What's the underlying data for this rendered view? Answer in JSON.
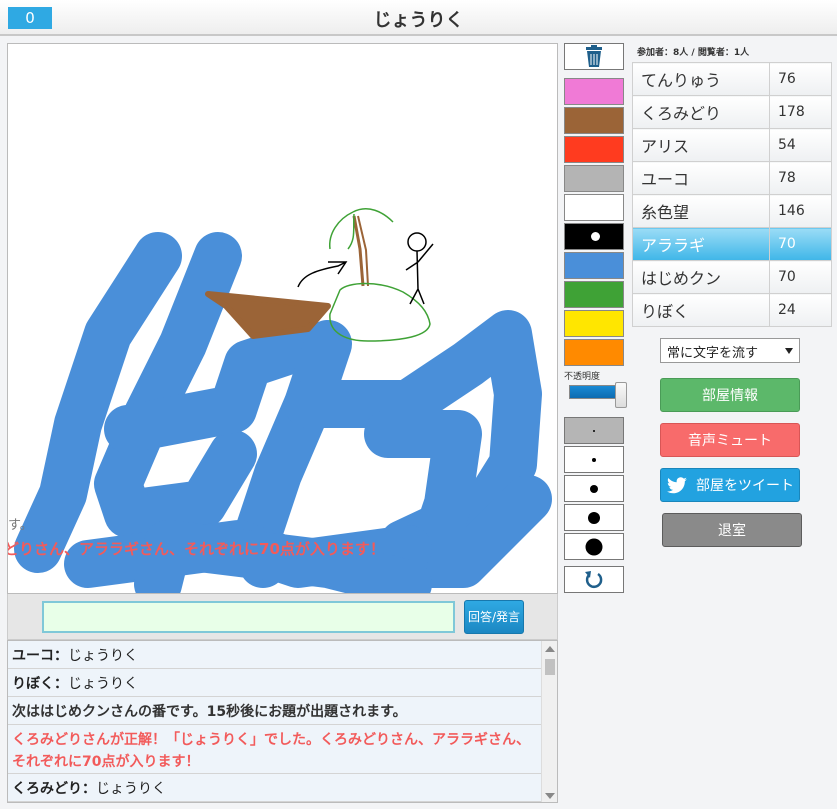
{
  "header": {
    "score": "0",
    "title": "じょうりく"
  },
  "canvas": {
    "marquee_line1": "す。",
    "marquee_line2": "どりさん、アララギさん、それぞれに70点が入ります！"
  },
  "answer": {
    "placeholder": "",
    "button_label": "回答/発言"
  },
  "chat": {
    "lines": [
      {
        "name": "ユーコ",
        "sep": "：",
        "text": "じょうりく"
      },
      {
        "name": "りぼく",
        "sep": "：",
        "text": "じょうりく"
      },
      {
        "system": "次ははじめクンさんの番です。15秒後にお題が出題されます。"
      },
      {
        "alert": "くろみどりさんが正解！「じょうりく」でした。くろみどりさん、アララギさん、それぞれに70点が入ります！"
      },
      {
        "name": "くろみどり",
        "sep": "：",
        "text": "じょうりく"
      }
    ]
  },
  "tools": {
    "trash_icon": "trash-icon",
    "undo_icon": "undo-icon",
    "opacity_label": "不透明度",
    "opacity_value": 1.0,
    "colors": [
      "#f07ad6",
      "#9b6437",
      "#ff3b1f",
      "#b4b4b4",
      "#ffffff",
      "#000000",
      "#4a8fd9",
      "#3fa236",
      "#ffe600",
      "#ff8a00"
    ],
    "selected_color_index": 5,
    "brush_sizes": [
      "xs",
      "s",
      "m",
      "l",
      "xl"
    ],
    "selected_brush_index": 0
  },
  "participants": {
    "header": "参加者：8人 / 閲覧者：1人",
    "players": [
      {
        "name": "てんりゅう",
        "score": "76"
      },
      {
        "name": "くろみどり",
        "score": "178"
      },
      {
        "name": "アリス",
        "score": "54"
      },
      {
        "name": "ユーコ",
        "score": "78"
      },
      {
        "name": "糸色望",
        "score": "146"
      },
      {
        "name": "アララギ",
        "score": "70"
      },
      {
        "name": "はじめクン",
        "score": "70"
      },
      {
        "name": "りぼく",
        "score": "24"
      }
    ],
    "active_index": 5
  },
  "controls": {
    "scroll_select": "常に文字を流す",
    "room_info": "部屋情報",
    "mute": "音声ミュート",
    "tweet": "部屋をツイート",
    "exit": "退室"
  }
}
